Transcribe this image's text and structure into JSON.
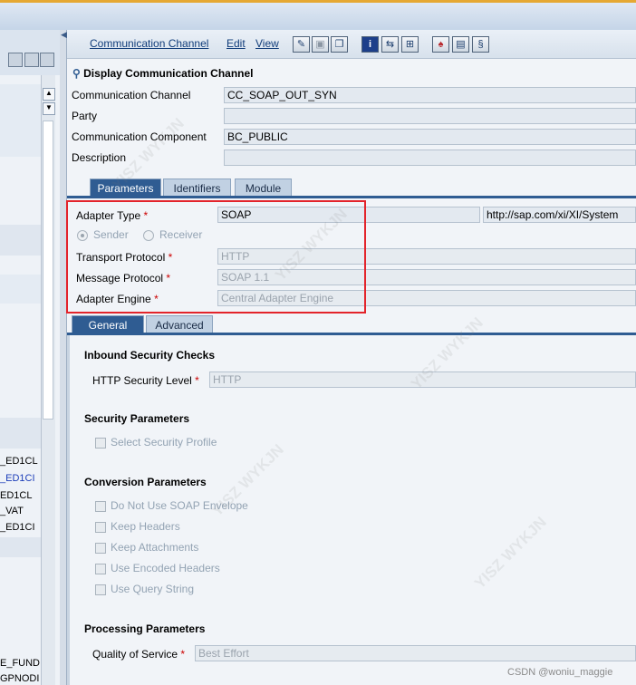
{
  "menu": {
    "channel": "Communication Channel",
    "edit": "Edit",
    "view": "View"
  },
  "toolbar_icons": [
    "pencil-icon",
    "save-icon",
    "copy-icon",
    "info-icon",
    "network-icon",
    "tree-icon",
    "hat-icon",
    "table-icon",
    "scroll-icon"
  ],
  "header": {
    "title": "Display Communication Channel"
  },
  "fields": {
    "channel": {
      "label": "Communication Channel",
      "value": "CC_SOAP_OUT_SYN"
    },
    "party": {
      "label": "Party",
      "value": ""
    },
    "component": {
      "label": "Communication Component",
      "value": "BC_PUBLIC"
    },
    "description": {
      "label": "Description",
      "value": ""
    }
  },
  "tabs": [
    "Parameters",
    "Identifiers",
    "Module"
  ],
  "adapter": {
    "type_label": "Adapter Type",
    "type_value": "SOAP",
    "namespace": "http://sap.com/xi/XI/System",
    "sender": "Sender",
    "receiver": "Receiver",
    "transport_label": "Transport Protocol",
    "transport_value": "HTTP",
    "message_label": "Message Protocol",
    "message_value": "SOAP 1.1",
    "engine_label": "Adapter Engine",
    "engine_value": "Central Adapter Engine",
    "req": "*"
  },
  "subtabs": [
    "General",
    "Advanced"
  ],
  "inbound": {
    "title": "Inbound Security Checks",
    "level_label": "HTTP Security Level",
    "level_value": "HTTP"
  },
  "security": {
    "title": "Security Parameters",
    "select_profile": "Select Security Profile"
  },
  "conversion": {
    "title": "Conversion Parameters",
    "options": [
      "Do Not Use SOAP Envelope",
      "Keep Headers",
      "Keep Attachments",
      "Use Encoded Headers",
      "Use Query String"
    ]
  },
  "processing": {
    "title": "Processing Parameters",
    "qos_label": "Quality of Service",
    "qos_value": "Best Effort"
  },
  "left_list": [
    "_ED1CL",
    "_ED1CI",
    "ED1CL",
    "_VAT",
    "_ED1CI",
    "E_FUND",
    "GPNODI"
  ],
  "watermark": "CSDN @woniu_maggie",
  "bg_watermark": "YISZ WYKJN"
}
